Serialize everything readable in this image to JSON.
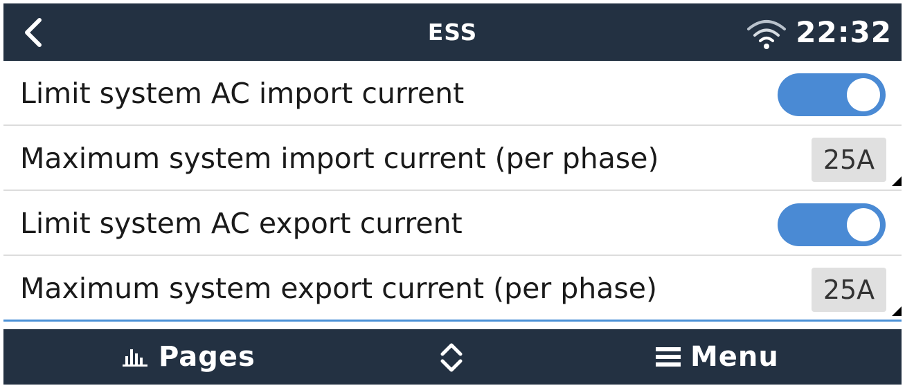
{
  "header": {
    "title": "ESS",
    "time": "22:32",
    "back_icon": "chevron-left-icon",
    "wifi_icon": "wifi-icon"
  },
  "settings": [
    {
      "label": "Limit system AC import current",
      "type": "toggle",
      "enabled": true
    },
    {
      "label": "Maximum system import current (per phase)",
      "type": "value",
      "value": "25A"
    },
    {
      "label": "Limit system AC export current",
      "type": "toggle",
      "enabled": true
    },
    {
      "label": "Maximum system export current (per phase)",
      "type": "value",
      "value": "25A"
    }
  ],
  "footer": {
    "pages_label": "Pages",
    "menu_label": "Menu",
    "pages_icon": "bar-chart-icon",
    "updown_icon": "up-down-chevron-icon",
    "menu_icon": "hamburger-menu-icon"
  },
  "colors": {
    "header_bg": "#233142",
    "toggle_on": "#4a8ad4",
    "accent_line": "#4a90d6"
  }
}
